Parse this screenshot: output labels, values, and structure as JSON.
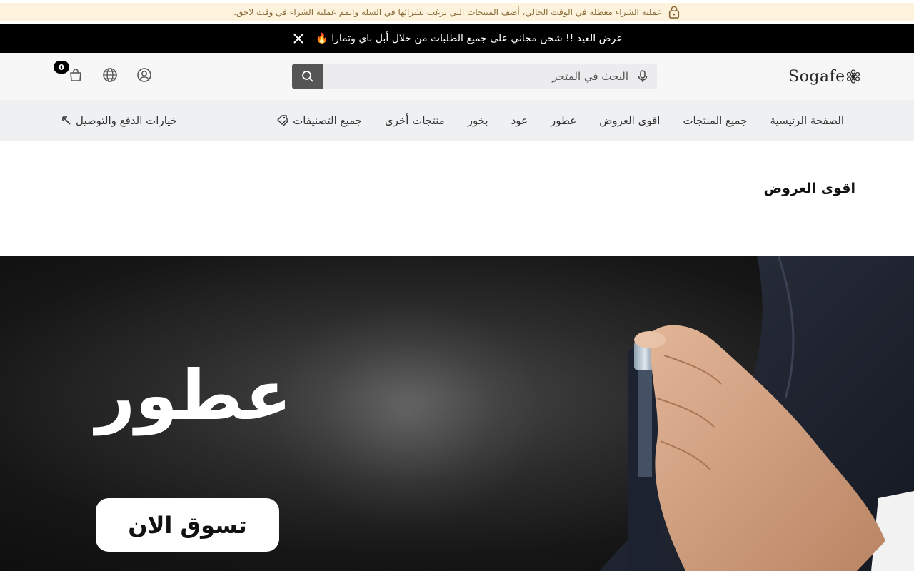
{
  "notice": {
    "text": "عملية الشراء معطلة في الوقت الحالي، أضف المنتجات التي ترغب بشرائها في السلة واتمم عملية الشراء في وقت لاحق."
  },
  "promo": {
    "text": "عرض العيد !! شحن مجاني على جميع الطلبات من خلال أبل باي وتمارا 🔥"
  },
  "header": {
    "logo_text": "Sogafe",
    "search_placeholder": "البحث في المتجر",
    "cart_count": "0"
  },
  "nav": {
    "items": [
      {
        "label": "الصفحة الرئيسية"
      },
      {
        "label": "جميع المنتجات"
      },
      {
        "label": "اقوى العروض"
      },
      {
        "label": "عطور"
      },
      {
        "label": "عود"
      },
      {
        "label": "بخور"
      },
      {
        "label": "منتجات أخرى"
      },
      {
        "label": "جميع التصنيفات"
      }
    ],
    "payment_link": "خيارات الدفع والتوصيل"
  },
  "section": {
    "title": "اقوى العروض"
  },
  "hero": {
    "title": "عطور",
    "button": "تسوق الان"
  },
  "colors": {
    "notice_bg": "#fdf3dd",
    "promo_bg": "#000000",
    "nav_bg": "#eff0f2",
    "search_btn": "#555555"
  }
}
